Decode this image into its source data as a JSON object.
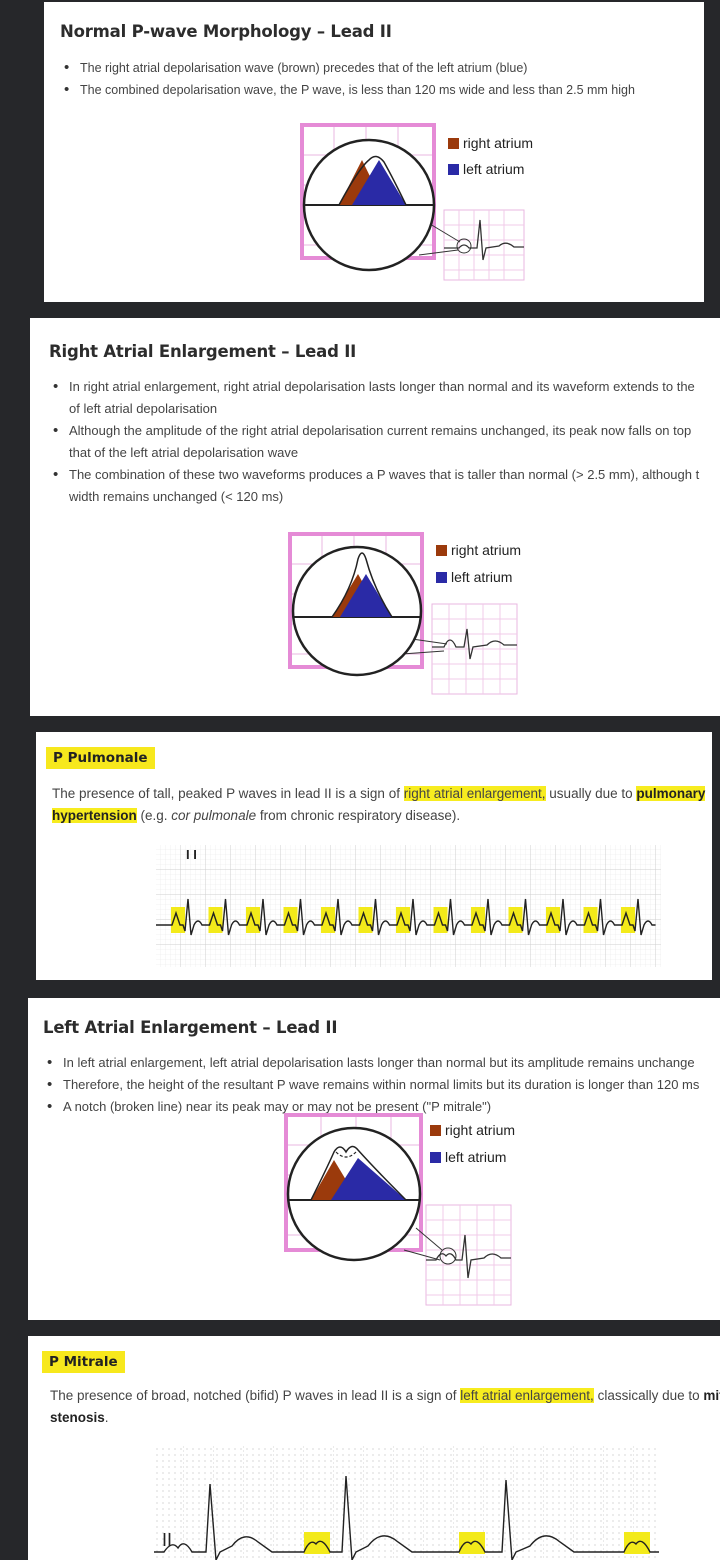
{
  "legend": {
    "right_atrium": "right atrium",
    "left_atrium": "left atrium"
  },
  "colors": {
    "right_atrium": "#9b3a0c",
    "left_atrium": "#2a2aa6",
    "highlight": "#f7ec1f",
    "pink": "#e58bd6"
  },
  "section1": {
    "title": "Normal P-wave Morphology – Lead II",
    "bullets": [
      "The right atrial depolarisation wave (brown) precedes that of the left atrium (blue)",
      "The combined depolarisation wave, the P wave, is less than 120 ms wide and less than 2.5 mm high"
    ]
  },
  "section2": {
    "title": "Right Atrial Enlargement – Lead II",
    "bullets": [
      [
        "In right atrial enlargement, right atrial depolarisation lasts longer than normal and its waveform extends to the",
        "of left atrial depolarisation"
      ],
      [
        "Although the amplitude of the right atrial depolarisation current remains unchanged, its peak now falls on top",
        "that of the left atrial depolarisation wave"
      ],
      [
        "The combination of these two waveforms produces a P waves that is taller than normal (> 2.5 mm), although t",
        "width remains unchanged (< 120 ms)"
      ]
    ]
  },
  "section3": {
    "label": "P Pulmonale",
    "text_a": "The presence of tall, peaked P waves in lead II is a sign of ",
    "hl_a": "right atrial enlargement,",
    "text_b": " usually due to ",
    "hl_b": "pulmonary",
    "hl_c": "hypertension",
    "text_c": " (e.g. ",
    "text_d": "cor pulmonale",
    "text_e": " from chronic respiratory disease).",
    "ecg_lead": "I I"
  },
  "section4": {
    "title": "Left Atrial Enlargement – Lead II",
    "bullets": [
      "In left atrial enlargement, left atrial depolarisation lasts longer than normal but its amplitude remains unchange",
      "Therefore, the height of the resultant P wave remains within normal limits but its duration is longer than 120 ms",
      "A notch (broken line) near its peak may or may not be present (\"P mitrale\")"
    ]
  },
  "section5": {
    "label": "P Mitrale",
    "text_a": "The presence of broad, notched (bifid) P waves in lead II is a sign of ",
    "hl_a": "left atrial enlargement,",
    "text_b": " classically due to ",
    "bold_a": "mitr",
    "bold_b": "stenosis",
    "text_c": ".",
    "ecg_lead": "II"
  }
}
